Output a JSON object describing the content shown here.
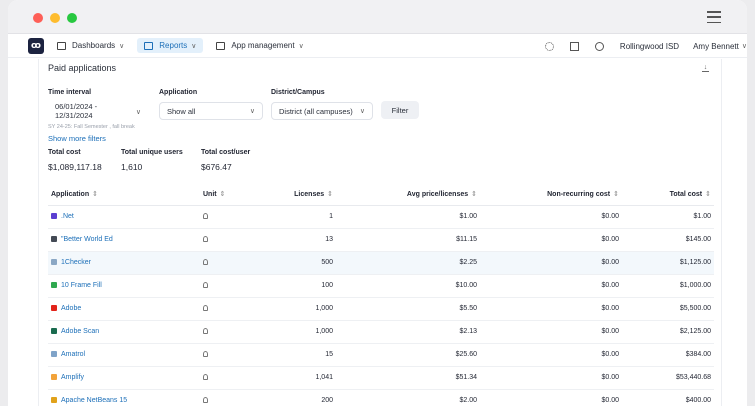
{
  "nav": {
    "items": [
      {
        "label": "Dashboards",
        "icon": "dashboard-icon"
      },
      {
        "label": "Reports",
        "icon": "reports-icon"
      },
      {
        "label": "App management",
        "icon": "app-management-icon"
      }
    ],
    "district": "Rollingwood ISD",
    "user": "Amy Bennett"
  },
  "card": {
    "title": "Paid applications"
  },
  "filters": {
    "time_interval_label": "Time interval",
    "date_start": "06/01/2024 -",
    "date_end": "12/31/2024",
    "application_label": "Application",
    "application_value": "Show all",
    "district_label": "District/Campus",
    "district_value": "District (all campuses)",
    "filter_button": "Filter",
    "sy_note": "SY 24-25: Fall Semester , fall break",
    "more_filters": "Show more filters"
  },
  "stats": [
    {
      "label": "Total cost",
      "value": "$1,089,117.18"
    },
    {
      "label": "Total unique users",
      "value": "1,610"
    },
    {
      "label": "Total cost/user",
      "value": "$676.47"
    }
  ],
  "table": {
    "columns": [
      "Application",
      "Unit",
      "Licenses",
      "Avg price/licenses",
      "Non-recurring cost",
      "Total cost"
    ],
    "rows": [
      {
        "app": ".Net",
        "icon_color": "#5b3fd1",
        "licenses": "1",
        "avg": "$1.00",
        "nonrec": "$0.00",
        "total": "$1.00"
      },
      {
        "app": "\"Better World Ed",
        "icon_color": "#444a55",
        "licenses": "13",
        "avg": "$11.15",
        "nonrec": "$0.00",
        "total": "$145.00"
      },
      {
        "app": "1Checker",
        "icon_color": "#8aa7c4",
        "licenses": "500",
        "avg": "$2.25",
        "nonrec": "$0.00",
        "total": "$1,125.00"
      },
      {
        "app": "10 Frame Fill",
        "icon_color": "#2fa84f",
        "licenses": "100",
        "avg": "$10.00",
        "nonrec": "$0.00",
        "total": "$1,000.00"
      },
      {
        "app": "Adobe",
        "icon_color": "#e2231a",
        "licenses": "1,000",
        "avg": "$5.50",
        "nonrec": "$0.00",
        "total": "$5,500.00"
      },
      {
        "app": "Adobe Scan",
        "icon_color": "#1a6b4f",
        "licenses": "1,000",
        "avg": "$2.13",
        "nonrec": "$0.00",
        "total": "$2,125.00"
      },
      {
        "app": "Amatrol",
        "icon_color": "#7fa3c8",
        "licenses": "15",
        "avg": "$25.60",
        "nonrec": "$0.00",
        "total": "$384.00"
      },
      {
        "app": "Amplify",
        "icon_color": "#f2a33a",
        "licenses": "1,041",
        "avg": "$51.34",
        "nonrec": "$0.00",
        "total": "$53,440.68"
      },
      {
        "app": "Apache NetBeans 15",
        "icon_color": "#e1a21b",
        "licenses": "200",
        "avg": "$2.00",
        "nonrec": "$0.00",
        "total": "$400.00"
      }
    ]
  }
}
